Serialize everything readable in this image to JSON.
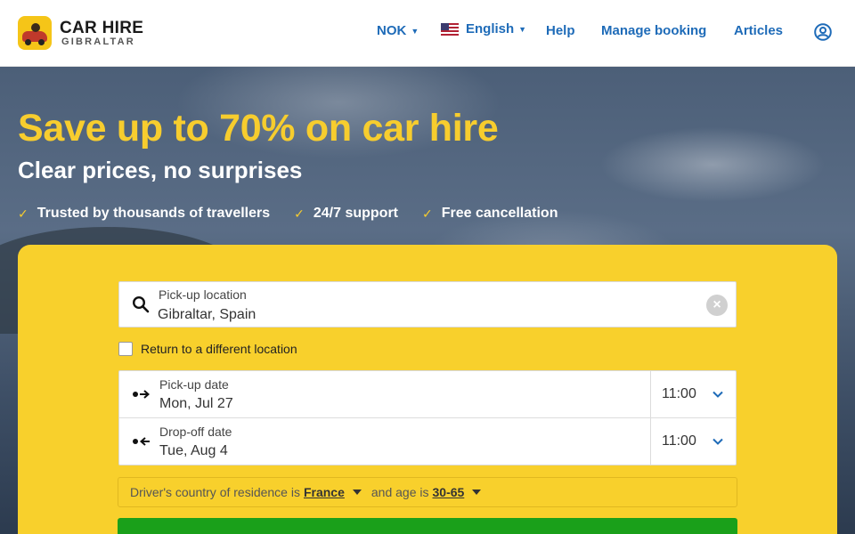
{
  "brand": {
    "title": "CAR HIRE",
    "subtitle": "GIBRALTAR"
  },
  "nav": {
    "currency": "NOK",
    "language": "English",
    "help": "Help",
    "manage_booking": "Manage booking",
    "articles": "Articles"
  },
  "hero": {
    "headline": "Save up to 70% on car hire",
    "subheadline": "Clear prices, no surprises",
    "features": [
      "Trusted by thousands of travellers",
      "24/7 support",
      "Free cancellation"
    ]
  },
  "search": {
    "pickup_location_label": "Pick-up location",
    "pickup_location_value": "Gibraltar, Spain",
    "return_different_label": "Return to a different location",
    "pickup_date_label": "Pick-up date",
    "pickup_date_value": "Mon, Jul 27",
    "pickup_time": "11:00",
    "dropoff_date_label": "Drop-off date",
    "dropoff_date_value": "Tue, Aug 4",
    "dropoff_time": "11:00",
    "residence_prefix": "Driver's country of residence is",
    "residence_country": "France",
    "age_prefix": "and age is",
    "age_value": "30-65"
  },
  "colors": {
    "accent": "#f8d02c",
    "link": "#1e6bb8",
    "cta": "#1aa01a"
  }
}
